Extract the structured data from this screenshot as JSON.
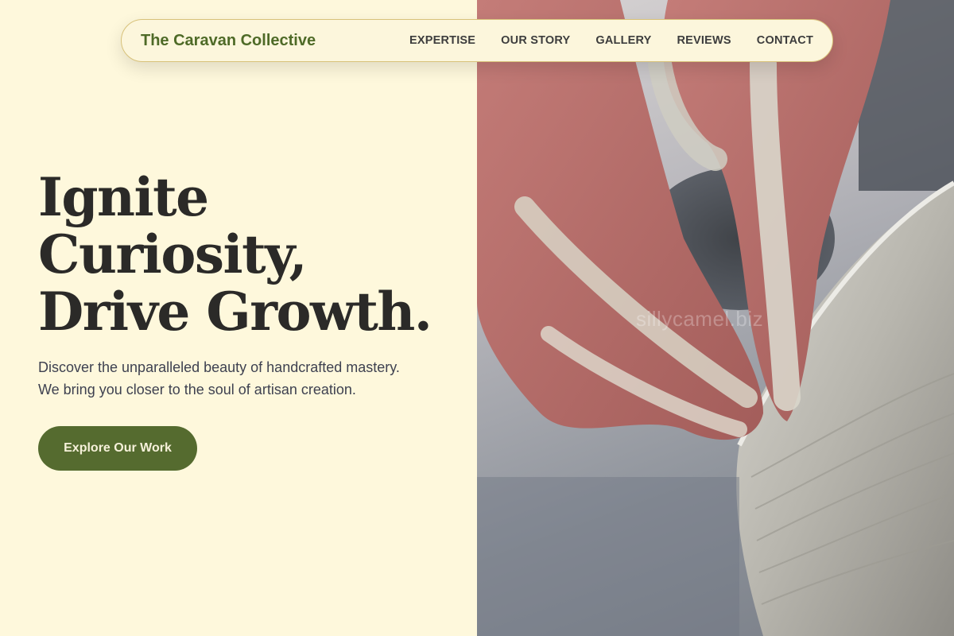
{
  "nav": {
    "brand": "The Caravan Collective",
    "links": [
      "EXPERTISE",
      "OUR STORY",
      "GALLERY",
      "REVIEWS",
      "CONTACT"
    ]
  },
  "hero": {
    "headline": [
      "Ignite",
      "Curiosity,",
      "Drive Growth."
    ],
    "subtext": [
      "Discover the unparalleled beauty of handcrafted mastery.",
      "We bring you closer to the soul of artisan creation."
    ],
    "cta_label": "Explore Our Work",
    "image_alt": "Hands shaping clay on a pottery wheel",
    "watermark": "sillycamel.biz"
  },
  "colors": {
    "background": "#fef8dc",
    "brand": "#4e6a27",
    "button": "#556b2f",
    "headline": "#2b2a28",
    "body_text": "#3e4150"
  }
}
